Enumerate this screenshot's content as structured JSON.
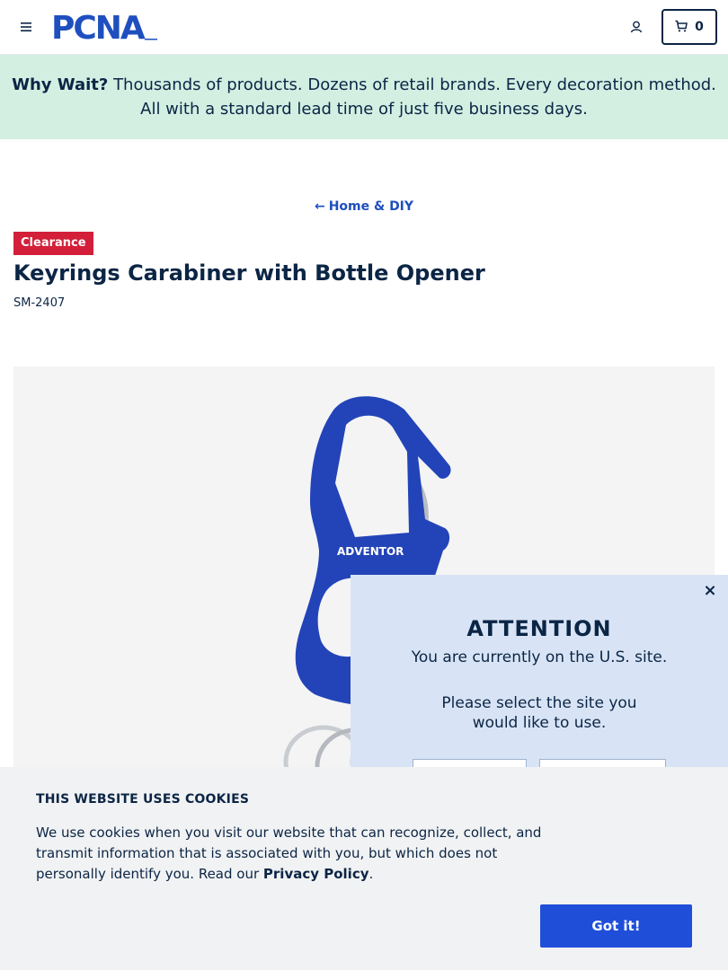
{
  "header": {
    "logo_text": "PCNA",
    "cart_count": "0"
  },
  "promo": {
    "lead": "Why Wait?",
    "text": " Thousands of products. Dozens of retail brands. Every decoration method. All with a standard lead time of just five business days."
  },
  "breadcrumb": {
    "arrow": "←",
    "label": "Home & DIY"
  },
  "product": {
    "badge": "Clearance",
    "title": "Keyrings Carabiner with Bottle Opener",
    "sku": "SM-2407",
    "imprint": "ADVENTOR",
    "product_color": "#2344b8"
  },
  "site_modal": {
    "close": "×",
    "title": "ATTENTION",
    "line1": "You are currently on the U.S. site.",
    "line2": "Please select the site you would like to use."
  },
  "cookie_banner": {
    "title": "THIS WEBSITE USES COOKIES",
    "text": "We use cookies when you visit our website that can recognize, collect, and transmit information that is associated with you, but which does not personally identify you. Read our ",
    "link": "Privacy Policy",
    "end": ".",
    "button": "Got it!"
  },
  "colors": {
    "brand_navy": "#0b2545",
    "promo_bg": "#d3efe2",
    "badge_red": "#d31f3a",
    "button_blue": "#1f4fd8"
  }
}
